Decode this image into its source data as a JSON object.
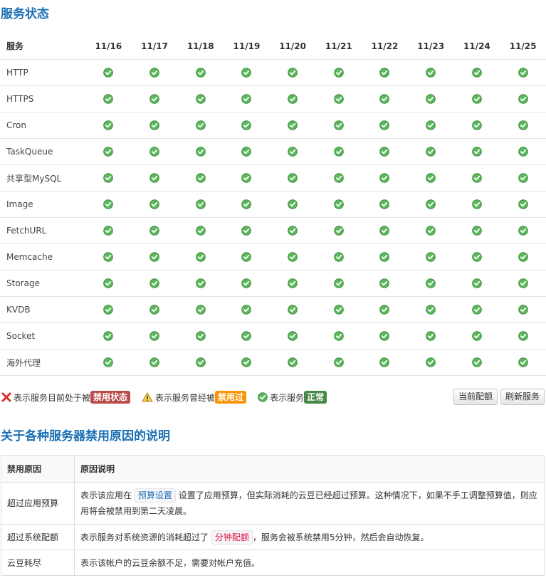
{
  "page": {
    "title": "服务状态",
    "reasons_title": "关于各种服务器禁用原因的说明"
  },
  "status_table": {
    "service_header": "服务",
    "dates": [
      "11/16",
      "11/17",
      "11/18",
      "11/19",
      "11/20",
      "11/21",
      "11/22",
      "11/23",
      "11/24",
      "11/25"
    ],
    "services": [
      "HTTP",
      "HTTPS",
      "Cron",
      "TaskQueue",
      "共享型MySQL",
      "Image",
      "FetchURL",
      "Memcache",
      "Storage",
      "KVDB",
      "Socket",
      "海外代理"
    ],
    "status_all": "ok"
  },
  "legend": {
    "disabled_text": "表示服务目前处于被",
    "disabled_tag": "禁用状态",
    "was_disabled_text": "表示服务曾经被",
    "was_disabled_tag": "禁用过",
    "normal_text": "表示服务",
    "normal_tag": "正常"
  },
  "buttons": {
    "current_quota": "当前配额",
    "refresh": "刷新服务"
  },
  "reasons_table": {
    "headers": [
      "禁用原因",
      "原因说明"
    ],
    "rows": [
      {
        "reason": "超过应用预算",
        "desc_pre": "表示该应用在",
        "code": "预算设置",
        "desc_post": "设置了应用预算，但实际消耗的云豆已经超过预算。这种情况下，如果不手工调整预算值，则应用将会被禁用到第二天凌晨。"
      },
      {
        "reason": "超过系统配额",
        "desc_pre": "表示服务对系统资源的消耗超过了",
        "code": "分钟配额",
        "desc_post": "，服务会被系统禁用5分钟，然后会自动恢复。"
      },
      {
        "reason": "云豆耗尽",
        "desc_pre": "表示该帐户的云豆余额不足，需要对帐户充值。",
        "code": "",
        "desc_post": ""
      }
    ]
  },
  "colors": {
    "accent": "#1a6fb5",
    "ok_green": "#5cb85c",
    "disabled_red": "#b94a48",
    "warning_orange": "#f89406",
    "normal_green": "#468847"
  }
}
